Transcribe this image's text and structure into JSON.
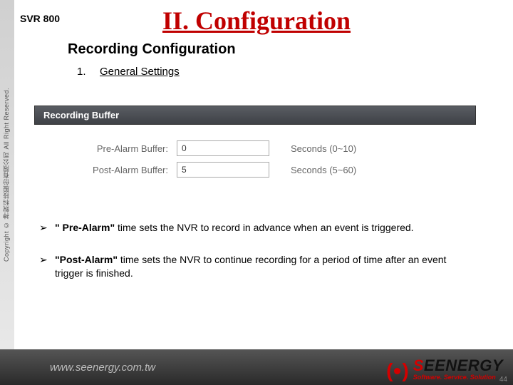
{
  "copyright": "Copyright © 神銳科技股份有限公司 All Right Reserved.",
  "product": "SVR 800",
  "title": "II.   Configuration",
  "subtitle": "Recording Configuration",
  "section_num": "1.",
  "section_label": "General Settings",
  "panel": {
    "header": "Recording Buffer",
    "rows": [
      {
        "label": "Pre-Alarm Buffer:",
        "value": "0",
        "unit": "Seconds (0~10)"
      },
      {
        "label": "Post-Alarm Buffer:",
        "value": "5",
        "unit": "Seconds (5~60)"
      }
    ]
  },
  "bullets": [
    {
      "bold": "\" Pre-Alarm\"",
      "rest": " time sets the NVR to record in advance when an event is triggered."
    },
    {
      "bold": "\"Post-Alarm\"",
      "rest": " time sets the NVR to continue recording for a period of time after an event trigger is finished."
    }
  ],
  "footer_url": "www.seenergy.com.tw",
  "brand": {
    "s": "S",
    "rest": "EENERGY",
    "tagline": "Software. Service. Solution"
  },
  "page": "44"
}
